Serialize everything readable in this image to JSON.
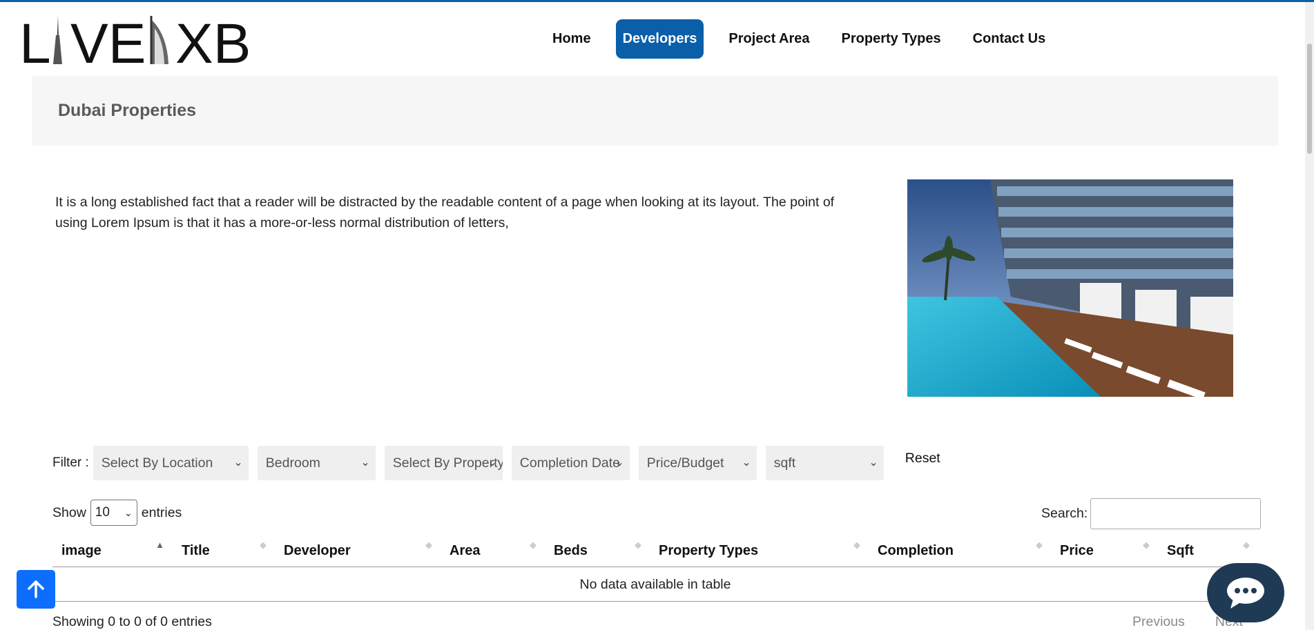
{
  "brand": {
    "logo_text_left": "L",
    "logo_text_mid": "VE",
    "logo_text_right": "XB",
    "accent": "#0a5fa8"
  },
  "nav": [
    {
      "label": "Home",
      "active": false
    },
    {
      "label": "Developers",
      "active": true
    },
    {
      "label": "Project Area",
      "active": false
    },
    {
      "label": "Property Types",
      "active": false
    },
    {
      "label": "Contact Us",
      "active": false
    }
  ],
  "page": {
    "title": "Dubai Properties",
    "intro": "It is a long established fact that a reader will be distracted by the readable content of a page when looking at its layout. The point of using Lorem Ipsum is that it has a more-or-less normal distribution of letters,"
  },
  "filters": {
    "label": "Filter :",
    "selects": [
      {
        "value": "Select By Location"
      },
      {
        "value": "Bedroom"
      },
      {
        "value": "Select By Property Type"
      },
      {
        "value": "Completion Date"
      },
      {
        "value": "Price/Budget"
      },
      {
        "value": "sqft"
      }
    ],
    "reset_label": "Reset"
  },
  "table_controls": {
    "show_label": "Show",
    "entries_value": "10",
    "entries_label": "entries",
    "search_label": "Search:",
    "search_value": ""
  },
  "table": {
    "columns": [
      "image",
      "Title",
      "Developer",
      "Area",
      "Beds",
      "Property Types",
      "Completion",
      "Price",
      "Sqft"
    ],
    "empty_message": "No data available in table",
    "info": "Showing 0 to 0 of 0 entries",
    "prev_label": "Previous",
    "next_label": "Next"
  },
  "icons": {
    "scroll_top": "arrow-up-icon",
    "chat": "chat-bubble-icon"
  }
}
